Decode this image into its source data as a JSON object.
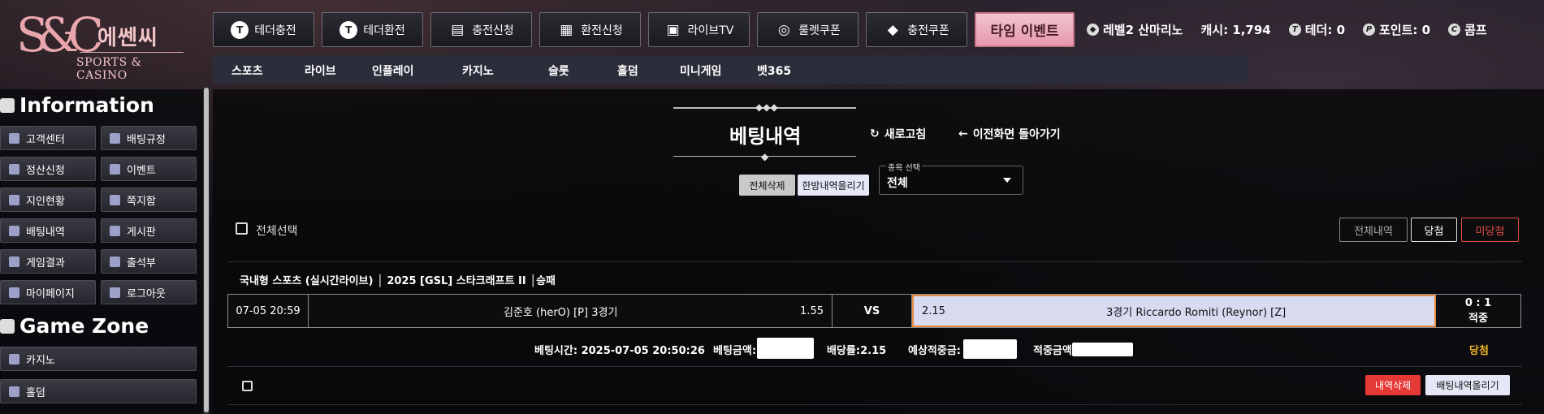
{
  "logo": {
    "mark": "S&C",
    "korean": "에쎈씨",
    "english": "SPORTS & CASINO"
  },
  "top_buttons": [
    {
      "label": "테더충전",
      "icon": "tether-icon"
    },
    {
      "label": "테더환전",
      "icon": "tether-icon"
    },
    {
      "label": "충전신청",
      "icon": "coins-icon"
    },
    {
      "label": "환전신청",
      "icon": "exchange-icon"
    },
    {
      "label": "라이브TV",
      "icon": "tv-icon"
    },
    {
      "label": "룰렛쿠폰",
      "icon": "roulette-icon"
    },
    {
      "label": "충전쿠폰",
      "icon": "ticket-icon"
    }
  ],
  "event_button": "타임 이벤트",
  "status": {
    "level": "레벨2 산마리노",
    "cash": "캐시: 1,794",
    "tether": "테더: 0",
    "points": "포인트: 0",
    "comp": "콤프"
  },
  "nav": [
    "스포츠",
    "라이브",
    "인플레이",
    "카지노",
    "슬롯",
    "홀덤",
    "미니게임",
    "벳365"
  ],
  "sidebar": {
    "info_title": "Information",
    "info_items": [
      {
        "label": "고객센터",
        "icon": "phone-icon"
      },
      {
        "label": "배팅규정",
        "icon": "rules-icon"
      },
      {
        "label": "정산신청",
        "icon": "settlement-icon"
      },
      {
        "label": "이벤트",
        "icon": "event-icon"
      },
      {
        "label": "지인현황",
        "icon": "friends-icon"
      },
      {
        "label": "쪽지함",
        "icon": "message-icon"
      },
      {
        "label": "배팅내역",
        "icon": "bet-history-icon"
      },
      {
        "label": "게시판",
        "icon": "board-icon"
      },
      {
        "label": "게임결과",
        "icon": "results-icon"
      },
      {
        "label": "출석부",
        "icon": "attendance-icon"
      },
      {
        "label": "마이페이지",
        "icon": "user-icon"
      },
      {
        "label": "로그아웃",
        "icon": "power-icon"
      }
    ],
    "game_title": "Game Zone",
    "game_items": [
      {
        "label": "카지노",
        "icon": "spade-icon"
      },
      {
        "label": "홀덤",
        "icon": "cards-icon"
      }
    ]
  },
  "main": {
    "title": "베팅내역",
    "refresh": "새로고침",
    "back": "이전화면 돌아가기",
    "delete_all": "전체삭제",
    "upload_all": "한방내역올리기",
    "select_label": "종목 선택",
    "select_value": "전체",
    "select_all": "전체선택",
    "filters": {
      "all": "전체내역",
      "win": "당첨",
      "lose": "미당첨"
    }
  },
  "bet": {
    "title": "국내형 스포츠 (실시간라이브) │ 2025 [GSL] 스타크래프트 II │승패",
    "time": "07-05 20:59",
    "home": "김준호 (herO) [P] 3경기",
    "home_odds": "1.55",
    "vs": "VS",
    "away_odds": "2.15",
    "away": "3경기 Riccardo Romiti (Reynor) [Z]",
    "score": "0 : 1",
    "hit": "적중",
    "bet_time": "베팅시간: 2025-07-05 20:50:26",
    "bet_amount_label": "베팅금액:",
    "odds": "배당률:2.15",
    "expected_label": "예상적중금:",
    "win_amount_label": "적중금액:",
    "result": "당첨",
    "delete": "내역삭제",
    "upload": "배팅내역올리기"
  }
}
